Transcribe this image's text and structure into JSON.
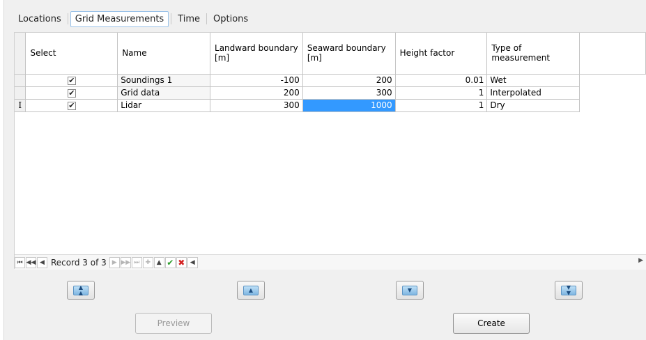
{
  "tabs": [
    {
      "label": "Locations"
    },
    {
      "label": "Grid Measurements"
    },
    {
      "label": "Time"
    },
    {
      "label": "Options"
    }
  ],
  "grid": {
    "headers": [
      "Select",
      "Name",
      "Landward boundary [m]",
      "Seaward boundary [m]",
      "Height factor",
      "Type of measurement"
    ],
    "rows": [
      {
        "indicator": "",
        "checked": "✔",
        "name": "Soundings 1",
        "landward": "-100",
        "seaward": "200",
        "height": "0.01",
        "type": "Wet"
      },
      {
        "indicator": "",
        "checked": "✔",
        "name": "Grid data",
        "landward": "200",
        "seaward": "300",
        "height": "1",
        "type": "Interpolated"
      },
      {
        "indicator": "I",
        "checked": "✔",
        "name": "Lidar",
        "landward": "300",
        "seaward": "1000",
        "height": "1",
        "type": "Dry"
      }
    ]
  },
  "navigator": {
    "record_text": "Record 3 of 3"
  },
  "buttons": {
    "preview": "Preview",
    "create": "Create"
  }
}
